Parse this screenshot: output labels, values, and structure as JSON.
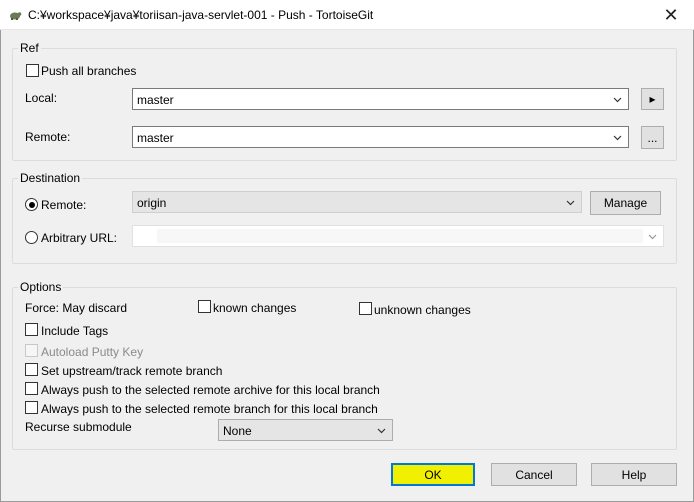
{
  "window": {
    "title": "C:¥workspace¥java¥toriisan-java-servlet-001 - Push - TortoiseGit",
    "close_glyph": "✕"
  },
  "ref": {
    "group_label": "Ref",
    "push_all_label": "Push all branches",
    "local_label": "Local:",
    "local_value": "master",
    "local_button": "▸",
    "remote_label": "Remote:",
    "remote_value": "master",
    "remote_button": "..."
  },
  "destination": {
    "group_label": "Destination",
    "remote_radio_label": "Remote:",
    "remote_value": "origin",
    "manage_button": "Manage",
    "url_radio_label": "Arbitrary URL:",
    "url_value": ""
  },
  "options": {
    "group_label": "Options",
    "force_label": "Force: May discard",
    "known_changes": "known changes",
    "unknown_changes": "unknown changes",
    "include_tags": "Include Tags",
    "autoload_putty": "Autoload Putty Key",
    "set_upstream": "Set upstream/track remote branch",
    "always_push_archive": "Always push to the selected remote archive for this local branch",
    "always_push_branch": "Always push to the selected remote branch for this local branch",
    "recurse_label": "Recurse submodule",
    "recurse_value": "None"
  },
  "buttons": {
    "ok": "OK",
    "cancel": "Cancel",
    "help": "Help"
  },
  "colors": {
    "ok_fill": "#f0f000",
    "ok_border": "#0078d7",
    "dialog_bg": "#f0f0f0"
  }
}
